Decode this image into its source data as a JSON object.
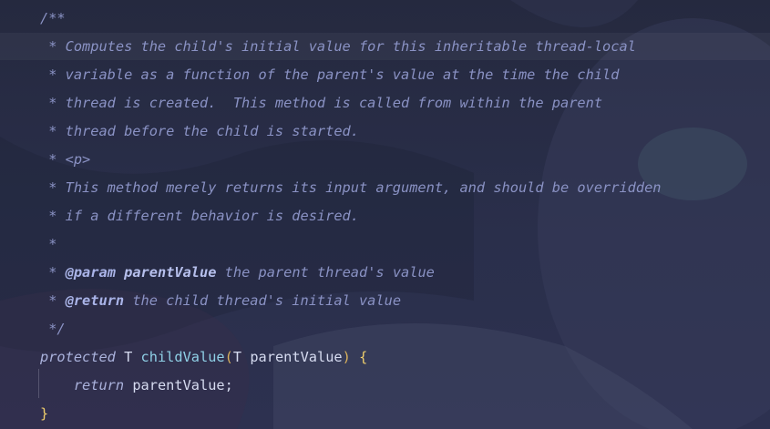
{
  "editor": {
    "doc_lines": [
      "/**",
      " * Computes the child's initial value for this inheritable thread-local",
      " * variable as a function of the parent's value at the time the child",
      " * thread is created.  This method is called from within the parent",
      " * thread before the child is started.",
      " * <p>",
      " * This method merely returns its input argument, and should be overridden",
      " * if a different behavior is desired.",
      " *"
    ],
    "param_line": {
      "prefix": " * ",
      "tag": "@param",
      "name": "parentValue",
      "text": " the parent thread's value"
    },
    "return_line": {
      "prefix": " * ",
      "tag": "@return",
      "text": " the child thread's initial value"
    },
    "doc_end": " */",
    "signature": {
      "modifier": "protected",
      "type": "T",
      "method": "childValue",
      "open_paren": "(",
      "param_type": "T",
      "param_name": "parentValue",
      "close_paren": ")",
      "open_brace": "{"
    },
    "body": {
      "keyword": "return",
      "expr": "parentValue;"
    },
    "close_brace": "}"
  },
  "colors": {
    "background": "#262a44",
    "doc_comment": "#8a92c4",
    "doc_tag": "#aab4e8",
    "function": "#8fd0e6",
    "paren": "#d9b15c",
    "brace": "#f0cf6c"
  }
}
